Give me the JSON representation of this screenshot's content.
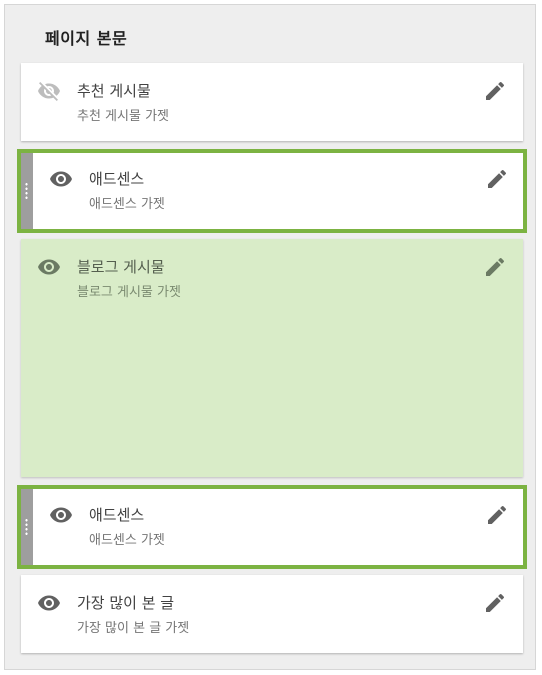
{
  "section": {
    "title": "페이지 본문"
  },
  "gadgets": [
    {
      "title": "추천 게시물",
      "subtitle": "추천 게시물 가젯",
      "visibility_icon": "visibility-off-icon",
      "edit_icon": "pencil-icon"
    },
    {
      "title": "애드센스",
      "subtitle": "애드센스 가젯",
      "visibility_icon": "visibility-icon",
      "edit_icon": "pencil-icon",
      "state": "dragging"
    },
    {
      "title": "블로그 게시물",
      "subtitle": "블로그 게시물 가젯",
      "visibility_icon": "visibility-icon",
      "edit_icon": "pencil-icon",
      "state": "drop-placeholder"
    },
    {
      "title": "애드센스",
      "subtitle": "애드센스 가젯",
      "visibility_icon": "visibility-icon",
      "edit_icon": "pencil-icon",
      "state": "dragging"
    },
    {
      "title": "가장 많이 본 글",
      "subtitle": "가장 많이 본 글 가젯",
      "visibility_icon": "visibility-icon",
      "edit_icon": "pencil-icon"
    }
  ],
  "colors": {
    "accent_green": "#7cb342",
    "placeholder_bg": "#d9ecc8",
    "icon_gray": "#616161",
    "icon_off_gray": "#bdbdbd"
  }
}
